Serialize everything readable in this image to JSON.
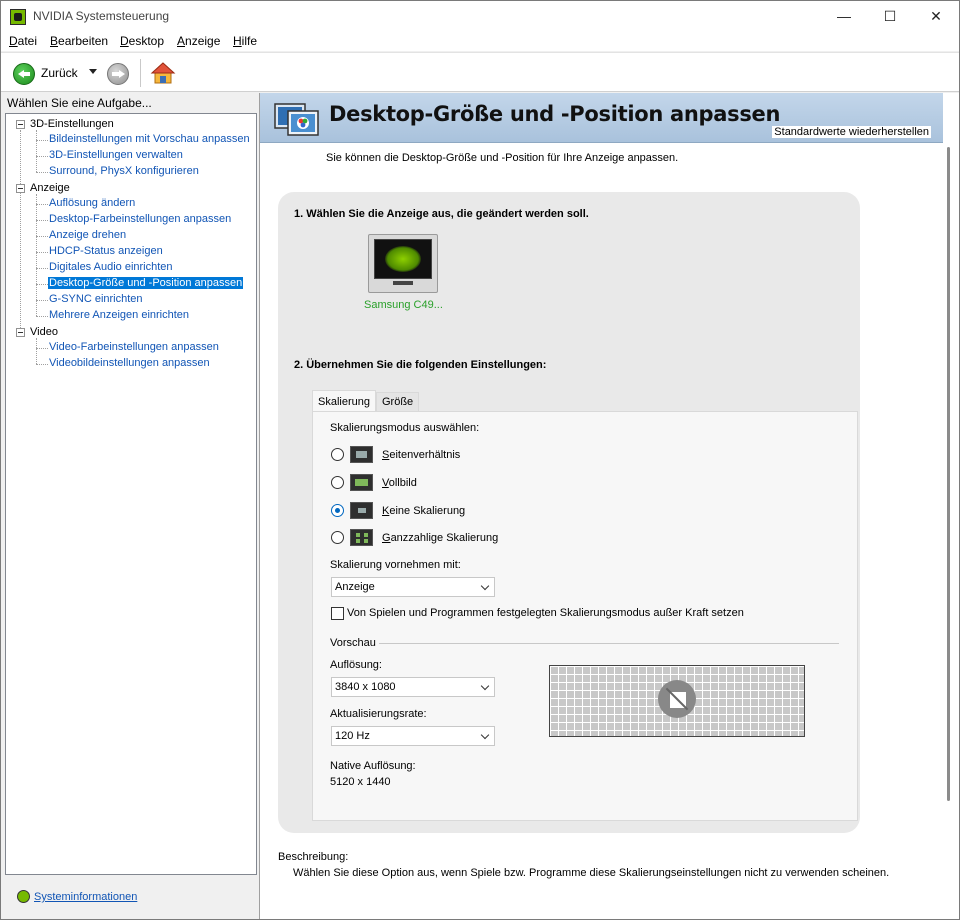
{
  "window": {
    "title": "NVIDIA Systemsteuerung",
    "controls": {
      "minimize": "—",
      "maximize": "☐",
      "close": "✕"
    }
  },
  "menu": [
    "Datei",
    "Bearbeiten",
    "Desktop",
    "Anzeige",
    "Hilfe"
  ],
  "toolbar": {
    "back_label": "Zurück"
  },
  "left": {
    "header": "Wählen Sie eine Aufgabe...",
    "groups": [
      {
        "label": "3D-Einstellungen",
        "items": [
          "Bildeinstellungen mit Vorschau anpassen",
          "3D-Einstellungen verwalten",
          "Surround, PhysX konfigurieren"
        ]
      },
      {
        "label": "Anzeige",
        "items": [
          "Auflösung ändern",
          "Desktop-Farbeinstellungen anpassen",
          "Anzeige drehen",
          "HDCP-Status anzeigen",
          "Digitales Audio einrichten",
          "Desktop-Größe und -Position anpassen",
          "G-SYNC einrichten",
          "Mehrere Anzeigen einrichten"
        ]
      },
      {
        "label": "Video",
        "items": [
          "Video-Farbeinstellungen anpassen",
          "Videobildeinstellungen anpassen"
        ]
      }
    ],
    "selected_item": "Desktop-Größe und -Position anpassen",
    "sysinfo": "Systeminformationen"
  },
  "page": {
    "title": "Desktop-Größe und -Position anpassen",
    "restore": "Standardwerte wiederherstellen",
    "intro": "Sie können die Desktop-Größe und -Position für Ihre Anzeige anpassen.",
    "step1": "1. Wählen Sie die Anzeige aus, die geändert werden soll.",
    "display_name": "Samsung C49...",
    "step2": "2. Übernehmen Sie die folgenden Einstellungen:",
    "tabs": [
      "Skalierung",
      "Größe"
    ],
    "scaling_mode_label": "Skalierungsmodus auswählen:",
    "scaling_options": [
      {
        "label": "Seitenverhältnis",
        "selected": false
      },
      {
        "label": "Vollbild",
        "selected": false
      },
      {
        "label": "Keine Skalierung",
        "selected": true
      },
      {
        "label": "Ganzzahlige Skalierung",
        "selected": false
      }
    ],
    "perform_label": "Skalierung vornehmen mit:",
    "perform_value": "Anzeige",
    "override_label": "Von Spielen und Programmen festgelegten Skalierungsmodus außer Kraft setzen",
    "override_checked": false,
    "preview_label": "Vorschau",
    "resolution_label": "Auflösung:",
    "resolution_value": "3840 x 1080",
    "refresh_label": "Aktualisierungsrate:",
    "refresh_value": "120 Hz",
    "native_label": "Native Auflösung:",
    "native_value": "5120 x 1440",
    "desc_head": "Beschreibung:",
    "desc_body": "Wählen Sie diese Option aus, wenn Spiele bzw. Programme diese Skalierungseinstellungen nicht zu verwenden scheinen."
  },
  "colors": {
    "accent": "#0078d7",
    "nvidia_green": "#76b900",
    "link": "#1155b5"
  }
}
